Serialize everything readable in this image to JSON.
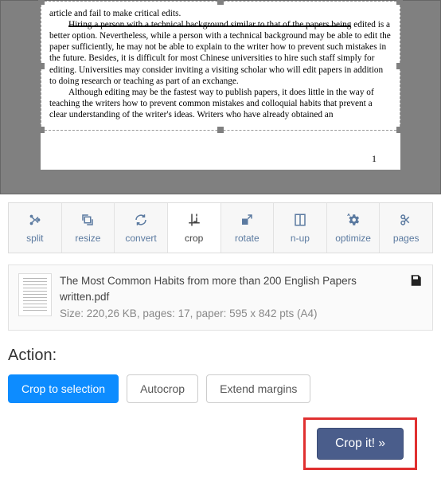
{
  "document": {
    "line_cut": "article and fail to make critical edits.",
    "para1_strike": "Hiring a person with a technical background similar to that of the papers being",
    "para1_rest": "edited is a better option. Nevertheless, while a person with a technical background may be able to edit the paper sufficiently, he may not be able to explain to the writer how to prevent such mistakes in the future.  Besides, it is difficult for most Chinese universities to hire such staff simply for editing.  Universities may consider inviting a visiting scholar who will edit papers in addition to doing research or teaching as part of an exchange.",
    "para2": "Although editing may be the fastest way to publish papers, it does little in the way of teaching the writers how to prevent common mistakes and colloquial habits that prevent a clear understanding of the writer's ideas.  Writers who have already obtained an",
    "page_number": "1"
  },
  "toolbar": {
    "split": "split",
    "resize": "resize",
    "convert": "convert",
    "crop": "crop",
    "rotate": "rotate",
    "nup": "n-up",
    "optimize": "optimize",
    "pages": "pages"
  },
  "file": {
    "name": "The Most Common Habits from more than 200 English Papers written.pdf",
    "meta": "Size: 220,26 KB, pages: 17, paper: 595 x 842 pts (A4)"
  },
  "action": {
    "label": "Action:",
    "crop_to_selection": "Crop to selection",
    "autocrop": "Autocrop",
    "extend_margins": "Extend margins",
    "submit": "Crop it! »"
  }
}
